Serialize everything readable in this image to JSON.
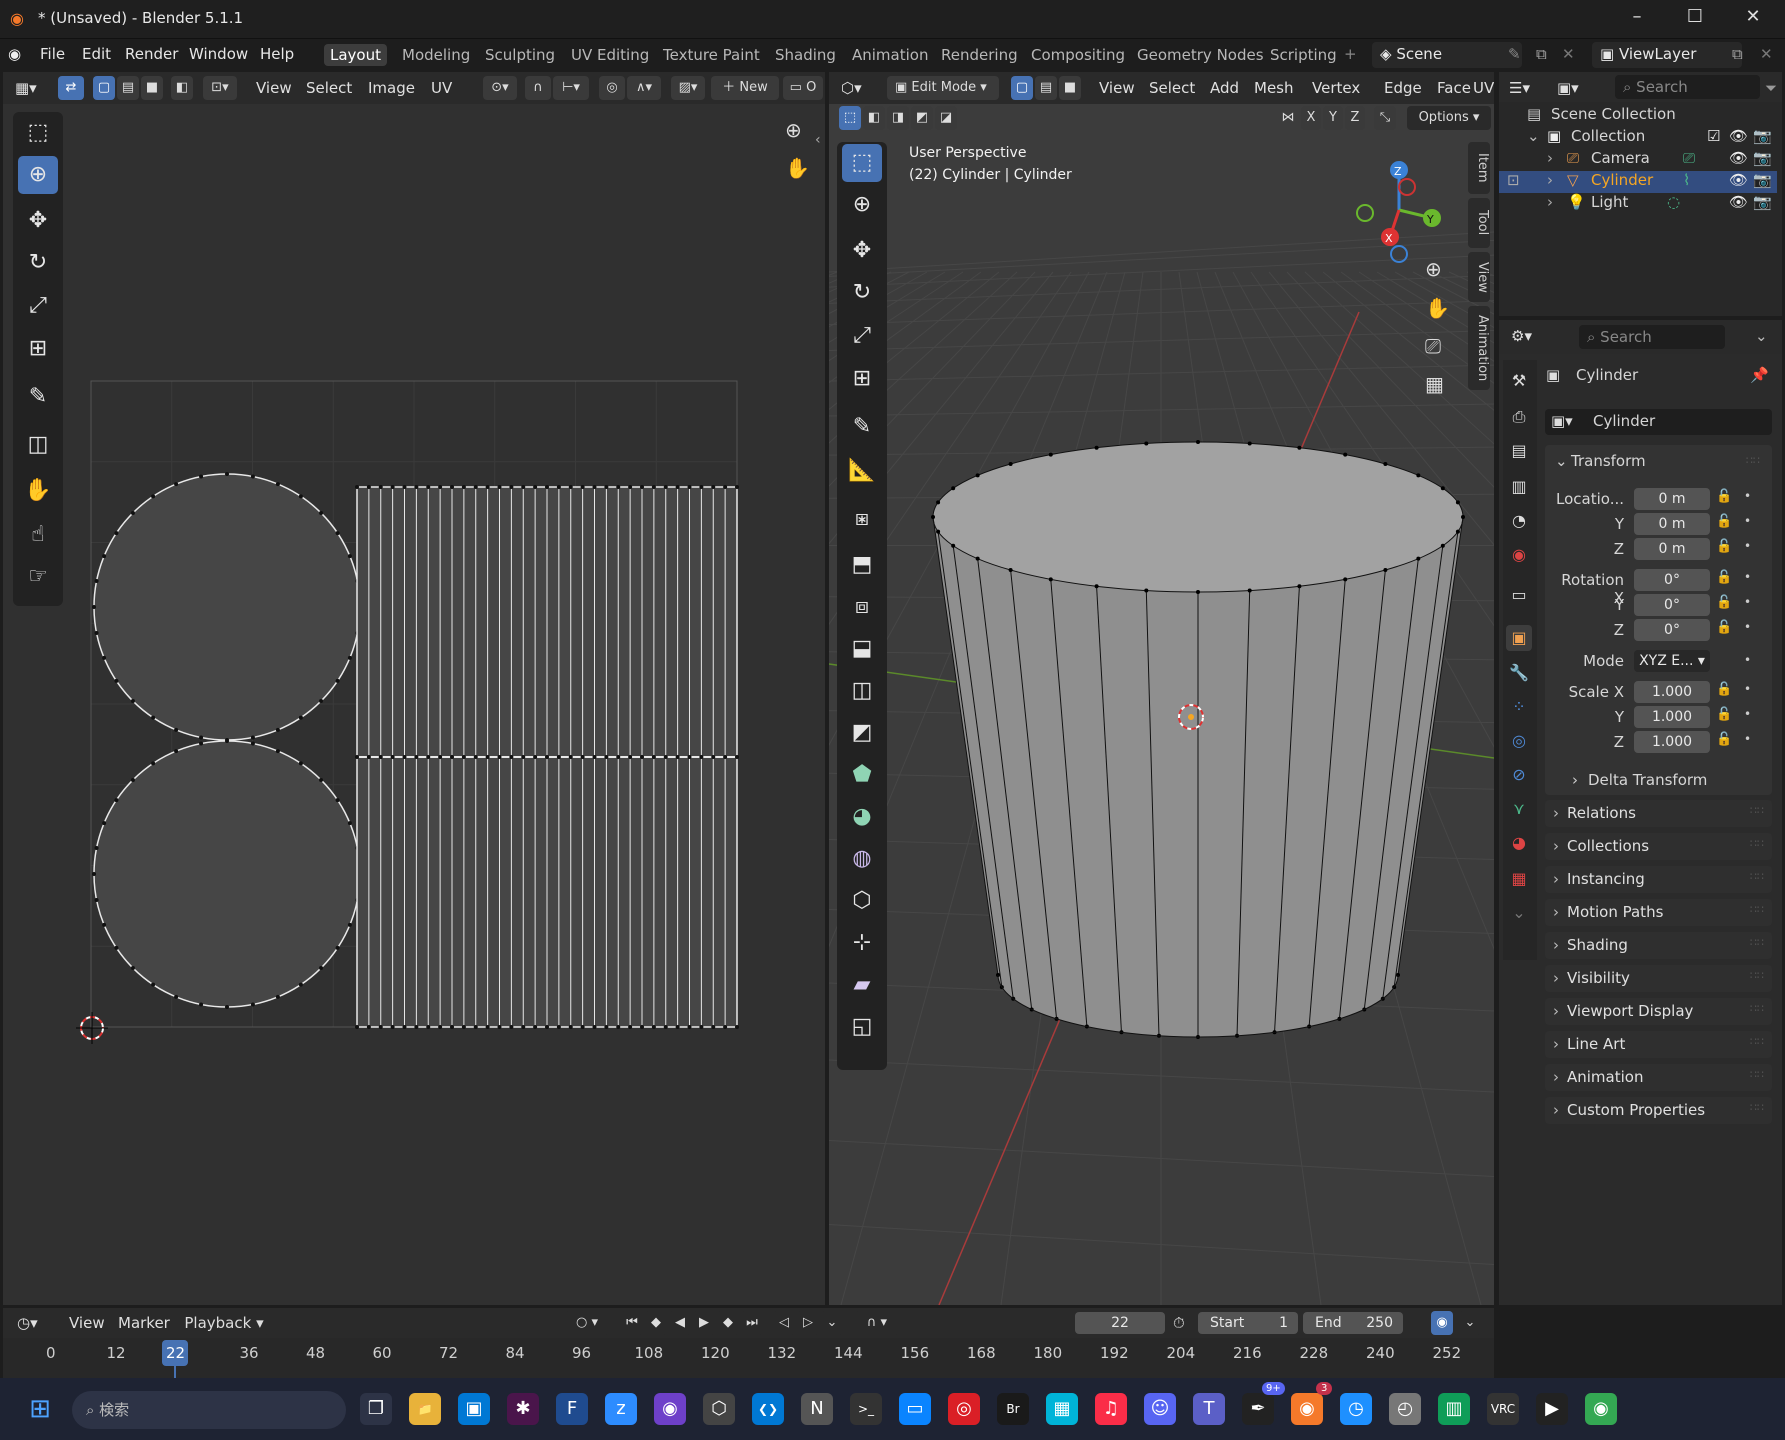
{
  "window": {
    "title": "* (Unsaved) - Blender 5.1.1",
    "minimize": "–",
    "maximize": "☐",
    "close": "✕"
  },
  "menu": {
    "file": "File",
    "edit": "Edit",
    "render": "Render",
    "window": "Window",
    "help": "Help"
  },
  "workspaces": [
    "Layout",
    "Modeling",
    "Sculpting",
    "UV Editing",
    "Texture Paint",
    "Shading",
    "Animation",
    "Rendering",
    "Compositing",
    "Geometry Nodes",
    "Scripting"
  ],
  "scene": {
    "name": "Scene",
    "view_layer": "ViewLayer"
  },
  "uv_editor": {
    "menu": [
      "View",
      "Select",
      "Image",
      "UV"
    ],
    "new_label": "New",
    "overflow_label": "O"
  },
  "viewport": {
    "mode": "Edit Mode",
    "menu": [
      "View",
      "Select",
      "Add",
      "Mesh",
      "Vertex",
      "Edge",
      "Face",
      "UV"
    ],
    "axes": [
      "X",
      "Y",
      "Z"
    ],
    "options_label": "Options",
    "overlay_line1": "User Perspective",
    "overlay_line2": "(22) Cylinder | Cylinder",
    "side_tabs": [
      "Item",
      "Tool",
      "View",
      "Animation"
    ],
    "gizmo_labels": {
      "z": "Z",
      "y": "Y",
      "x": "X"
    }
  },
  "outliner": {
    "search_placeholder": "Search",
    "scene_collection": "Scene Collection",
    "collection": "Collection",
    "items": [
      "Camera",
      "Cylinder",
      "Light"
    ]
  },
  "properties": {
    "search_placeholder": "Search",
    "object_name": "Cylinder",
    "data_name": "Cylinder",
    "transform_label": "Transform",
    "location_label": "Locatio...",
    "location": [
      "0 m",
      "0 m",
      "0 m"
    ],
    "rotation_label": "Rotation X",
    "rotation": [
      "0°",
      "0°",
      "0°"
    ],
    "mode_label": "Mode",
    "mode_value": "XYZ E...",
    "scale_label": "Scale X",
    "scale": [
      "1.000",
      "1.000",
      "1.000"
    ],
    "axis_y": "Y",
    "axis_z": "Z",
    "delta_label": "Delta Transform",
    "panels": [
      "Relations",
      "Collections",
      "Instancing",
      "Motion Paths",
      "Shading",
      "Visibility",
      "Viewport Display",
      "Line Art",
      "Animation",
      "Custom Properties"
    ]
  },
  "timeline": {
    "menu": [
      "View",
      "Marker",
      "Playback"
    ],
    "current_frame": "22",
    "start_label": "Start",
    "start": "1",
    "end_label": "End",
    "end": "250",
    "ticks": [
      "0",
      "12",
      "22",
      "36",
      "48",
      "60",
      "72",
      "84",
      "96",
      "108",
      "120",
      "132",
      "144",
      "156",
      "168",
      "180",
      "192",
      "204",
      "216",
      "228",
      "240",
      "252"
    ]
  },
  "taskbar": {
    "search_placeholder": "検索",
    "badges": {
      "discord": "9+",
      "teams": "3"
    }
  },
  "colors": {
    "accent": "#4772b3",
    "selected_text": "#f5a623",
    "active_tab": "#3d3d3d"
  }
}
